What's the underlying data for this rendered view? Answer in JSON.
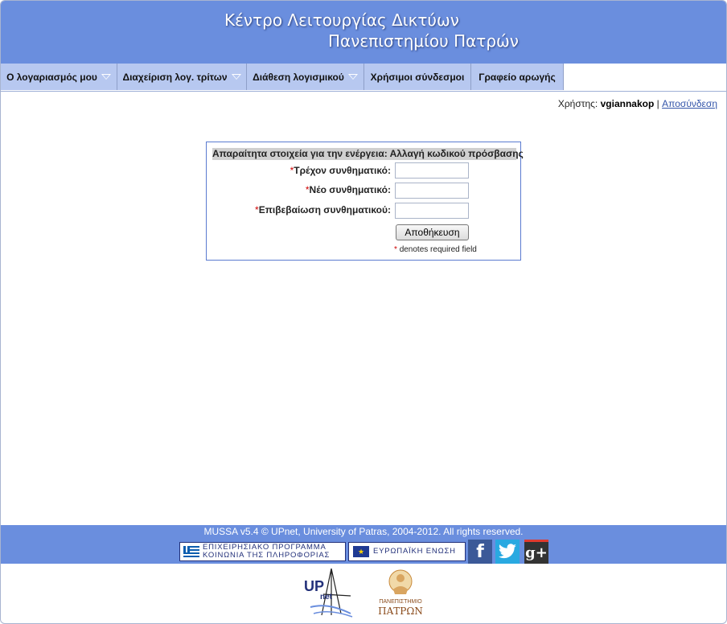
{
  "header": {
    "title_line1": "Κέντρο Λειτουργίας Δικτύων",
    "title_line2": "Πανεπιστημίου Πατρών"
  },
  "nav": {
    "items": [
      {
        "label": "Ο λογαριασμός μου",
        "icon": "dropdown-triangle-icon"
      },
      {
        "label": "Διαχείριση λογ. τρίτων",
        "icon": "dropdown-triangle-icon"
      },
      {
        "label": "Διάθεση λογισμικού",
        "icon": "dropdown-triangle-icon"
      },
      {
        "label": "Χρήσιμοι σύνδεσμοι"
      },
      {
        "label": "Γραφείο αρωγής"
      }
    ]
  },
  "user": {
    "prefix": "Χρήστης:",
    "username": "vgiannakop",
    "separator": "|",
    "logout_label": "Αποσύνδεση"
  },
  "form": {
    "heading": "Απαραίτητα στοιχεία για την ενέργεια: Αλλαγή κωδικού πρόσβασης",
    "required_mark": "*",
    "fields": [
      {
        "label": "Τρέχον συνθηματικό:",
        "value": ""
      },
      {
        "label": "Νέο συνθηματικό:",
        "value": ""
      },
      {
        "label": "Επιβεβαίωση συνθηματικού:",
        "value": ""
      }
    ],
    "save_label": "Αποθήκευση",
    "required_note": "denotes required field"
  },
  "footer": {
    "copyright": "MUSSA v5.4 © UPnet, University of Patras, 2004-2012. All rights reserved.",
    "banner1_line1": "ΕΠΙΧΕΙΡΗΣΙΑΚΟ ΠΡΟΓΡΑΜΜΑ",
    "banner1_line2": "ΚΟΙΝΩΝΙΑ ΤΗΣ ΠΛΗΡΟΦΟΡΙΑΣ",
    "banner2_text": "ΕΥΡΩΠΑΪΚΗ ΕΝΩΣΗ",
    "social": [
      {
        "name": "facebook",
        "glyph": "f",
        "color": "#3b5998"
      },
      {
        "name": "twitter",
        "glyph": "t",
        "color": "#29a9e1"
      },
      {
        "name": "google-plus",
        "glyph": "g+",
        "color": "#333333"
      }
    ]
  },
  "logos": {
    "upnet_text": "UP",
    "upnet_sub": "net",
    "upatras_line1": "ΠΑΝΕΠΙΣΤΗΜΙΟ",
    "upatras_line2": "ΠΑΤΡΩΝ"
  },
  "colors": {
    "accent": "#6a8ede",
    "nav_bg": "#b7c8f0",
    "required": "#cc0000"
  }
}
